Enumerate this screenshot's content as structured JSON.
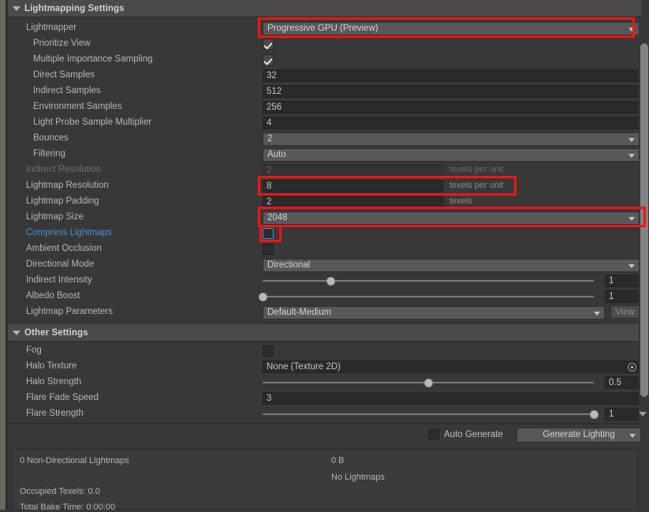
{
  "window": {
    "sections": [
      {
        "id": "lightmapping",
        "title": "Lightmapping Settings",
        "expanded_icon": "triangle-down-icon"
      },
      {
        "id": "other",
        "title": "Other Settings",
        "expanded_icon": "triangle-down-icon"
      }
    ]
  },
  "lightmapping": {
    "rows": [
      {
        "label": "Lightmapper",
        "type": "dropdown",
        "value": "Progressive GPU (Preview)",
        "indent": 1,
        "highlighted": true
      },
      {
        "label": "Prioritize View",
        "type": "checkbox",
        "value": "checked",
        "indent": 2
      },
      {
        "label": "Multiple Importance Sampling",
        "type": "checkbox",
        "value": "checked",
        "indent": 2
      },
      {
        "label": "Direct Samples",
        "type": "text",
        "value": "32",
        "indent": 2
      },
      {
        "label": "Indirect Samples",
        "type": "text",
        "value": "512",
        "indent": 2
      },
      {
        "label": "Environment Samples",
        "type": "text",
        "value": "256",
        "indent": 2
      },
      {
        "label": "Light Probe Sample Multiplier",
        "type": "text",
        "value": "4",
        "indent": 2
      },
      {
        "label": "Bounces",
        "type": "dropdown",
        "value": "2",
        "indent": 2
      },
      {
        "label": "Filtering",
        "type": "dropdown",
        "value": "Auto",
        "indent": 2
      },
      {
        "label": "Indirect Resolution",
        "type": "text-unit",
        "value": "2",
        "unit": "texels per unit",
        "indent": 1,
        "disabled": true
      },
      {
        "label": "Lightmap Resolution",
        "type": "text-unit",
        "value": "8",
        "unit": "texels per unit",
        "indent": 1,
        "highlighted": true
      },
      {
        "label": "Lightmap Padding",
        "type": "text-unit",
        "value": "2",
        "unit": "texels",
        "indent": 1
      },
      {
        "label": "Lightmap Size",
        "type": "dropdown",
        "value": "2048",
        "indent": 1,
        "highlighted": true
      },
      {
        "label": "Compress Lightmaps",
        "type": "checkbox",
        "value": "unchecked",
        "indent": 1,
        "link": true,
        "highlighted": true,
        "focused": true
      },
      {
        "label": "Ambient Occlusion",
        "type": "checkbox",
        "value": "unchecked",
        "indent": 1
      },
      {
        "label": "Directional Mode",
        "type": "dropdown",
        "value": "Directional",
        "indent": 1
      },
      {
        "label": "Indirect Intensity",
        "type": "slider",
        "value": "1",
        "fraction": 0.205,
        "indent": 1
      },
      {
        "label": "Albedo Boost",
        "type": "slider",
        "value": "1",
        "fraction": 0.0,
        "indent": 1
      },
      {
        "label": "Lightmap Parameters",
        "type": "dropdown-button",
        "value": "Default-Medium",
        "button": "View",
        "indent": 1
      }
    ]
  },
  "other": {
    "rows": [
      {
        "label": "Fog",
        "type": "checkbox",
        "value": "unchecked",
        "indent": 1
      },
      {
        "label": "Halo Texture",
        "type": "object",
        "value": "None (Texture 2D)",
        "indent": 1
      },
      {
        "label": "Halo Strength",
        "type": "slider",
        "value": "0.5",
        "fraction": 0.5,
        "indent": 1
      },
      {
        "label": "Flare Fade Speed",
        "type": "text",
        "value": "3",
        "indent": 1
      },
      {
        "label": "Flare Strength",
        "type": "slider",
        "value": "1",
        "fraction": 1.0,
        "indent": 1
      }
    ]
  },
  "footer": {
    "auto_generate_label": "Auto Generate",
    "auto_generate_checked": "unchecked",
    "generate_button": "Generate Lighting",
    "generate_dropdown_icon": "triangle-down-icon"
  },
  "status": {
    "lightmaps_count": "0 Non-Directional Lightmaps",
    "size": "0 B",
    "no_lightmaps": "No Lightmaps",
    "occupied_texels": "Occupied Texels: 0.0",
    "total_bake_time": "Total Bake Time: 0:00:00"
  },
  "scrollbar": {
    "visible": true,
    "down_arrow_icon": "triangle-down-icon"
  },
  "colors": {
    "background": "#383838",
    "header": "#4a4a4a",
    "field": "#2a2a2a",
    "dropdown": "#585858",
    "accent_link": "#4c90dd",
    "annotation": "#f51414"
  }
}
